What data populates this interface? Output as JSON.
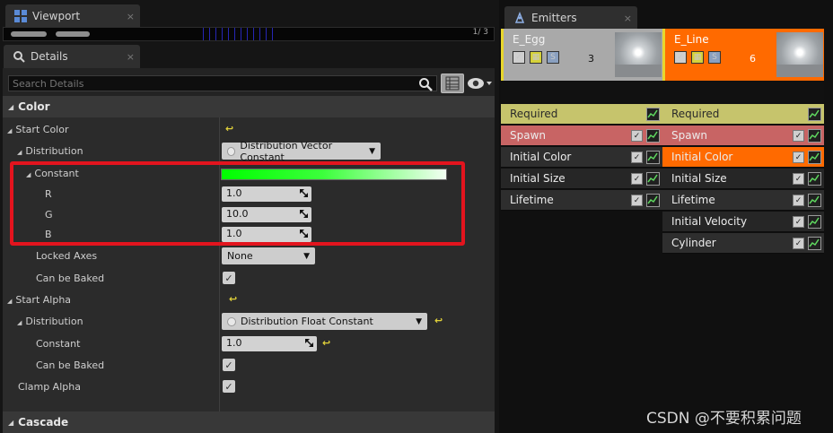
{
  "viewport": {
    "tab_label": "Viewport",
    "close_glyph": "×",
    "count_text": "1/  3"
  },
  "details": {
    "tab_label": "Details",
    "close_glyph": "×",
    "search_placeholder": "Search Details",
    "sections": {
      "color": {
        "title": "Color"
      },
      "cascade": {
        "title": "Cascade"
      }
    },
    "rows": {
      "start_color": "Start Color",
      "distribution": "Distribution",
      "distribution_value": "Distribution Vector Constant",
      "constant": "Constant",
      "r_label": "R",
      "r_value": "1.0",
      "g_label": "G",
      "g_value": "10.0",
      "b_label": "B",
      "b_value": "1.0",
      "locked_axes": "Locked Axes",
      "locked_axes_value": "None",
      "can_be_baked": "Can be Baked",
      "start_alpha": "Start Alpha",
      "distribution_alpha": "Distribution",
      "distribution_alpha_value": "Distribution Float Constant",
      "constant_alpha": "Constant",
      "constant_alpha_value": "1.0",
      "can_be_baked_alpha": "Can be Baked",
      "clamp_alpha": "Clamp Alpha"
    },
    "constant_color_hex": "#00ff00"
  },
  "emitters": {
    "tab_label": "Emitters",
    "close_glyph": "×",
    "list": [
      {
        "name": "E_Egg",
        "count": "3",
        "header_color": "#a9a9a9",
        "accent_color": "#e8d62c",
        "modules": [
          {
            "label": "Required",
            "bg": "#c6c46c"
          },
          {
            "label": "Spawn",
            "bg": "#c86464"
          },
          {
            "label": "Initial Color",
            "bg": "#2e2e2e"
          },
          {
            "label": "Initial Size",
            "bg": "#262626"
          },
          {
            "label": "Lifetime",
            "bg": "#2e2e2e"
          }
        ]
      },
      {
        "name": "E_Line",
        "count": "6",
        "header_color": "#ff6a00",
        "accent_color": "#e8d62c",
        "modules": [
          {
            "label": "Required",
            "bg": "#c6c46c"
          },
          {
            "label": "Spawn",
            "bg": "#c86464"
          },
          {
            "label": "Initial Color",
            "bg": "#ff6a00"
          },
          {
            "label": "Initial Size",
            "bg": "#262626"
          },
          {
            "label": "Lifetime",
            "bg": "#2e2e2e"
          },
          {
            "label": "Initial Velocity",
            "bg": "#262626"
          },
          {
            "label": "Cylinder",
            "bg": "#2e2e2e"
          }
        ]
      }
    ],
    "icons": [
      "checkbox-icon",
      "solo-icon",
      "s-icon"
    ]
  },
  "watermark": "CSDN @不要积累问题"
}
